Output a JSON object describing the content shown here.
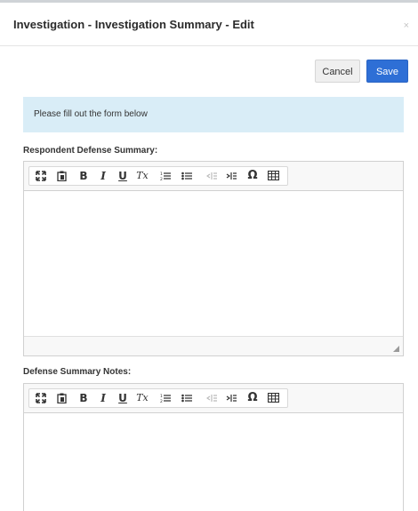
{
  "modal": {
    "title": "Investigation - Investigation Summary - Edit",
    "close_glyph": "×"
  },
  "actions": {
    "cancel_label": "Cancel",
    "save_label": "Save"
  },
  "alert": {
    "text": "Please fill out the form below"
  },
  "fields": [
    {
      "label": "Respondent Defense Summary:"
    },
    {
      "label": "Defense Summary Notes:"
    }
  ],
  "toolbar": {
    "buttons": [
      {
        "name": "maximize-icon",
        "glyph": "⛶",
        "enabled": true
      },
      {
        "name": "paste-icon",
        "glyph": "📋",
        "enabled": true
      },
      {
        "name": "bold-icon",
        "glyph": "B",
        "enabled": true
      },
      {
        "name": "italic-icon",
        "glyph": "I",
        "enabled": true
      },
      {
        "name": "underline-icon",
        "glyph": "U",
        "enabled": true
      },
      {
        "name": "remove-format-icon",
        "glyph": "Tx",
        "enabled": true
      },
      {
        "name": "numbered-list-icon",
        "glyph": "1≡",
        "enabled": true
      },
      {
        "name": "bulleted-list-icon",
        "glyph": "•≡",
        "enabled": true
      },
      {
        "name": "outdent-icon",
        "glyph": "⇤",
        "enabled": false
      },
      {
        "name": "indent-icon",
        "glyph": "⇥",
        "enabled": true
      },
      {
        "name": "special-char-icon",
        "glyph": "Ω",
        "enabled": true
      },
      {
        "name": "table-icon",
        "glyph": "▦",
        "enabled": true
      }
    ]
  },
  "colors": {
    "primary": "#2e6fd6",
    "alert_bg": "#d9edf7"
  }
}
